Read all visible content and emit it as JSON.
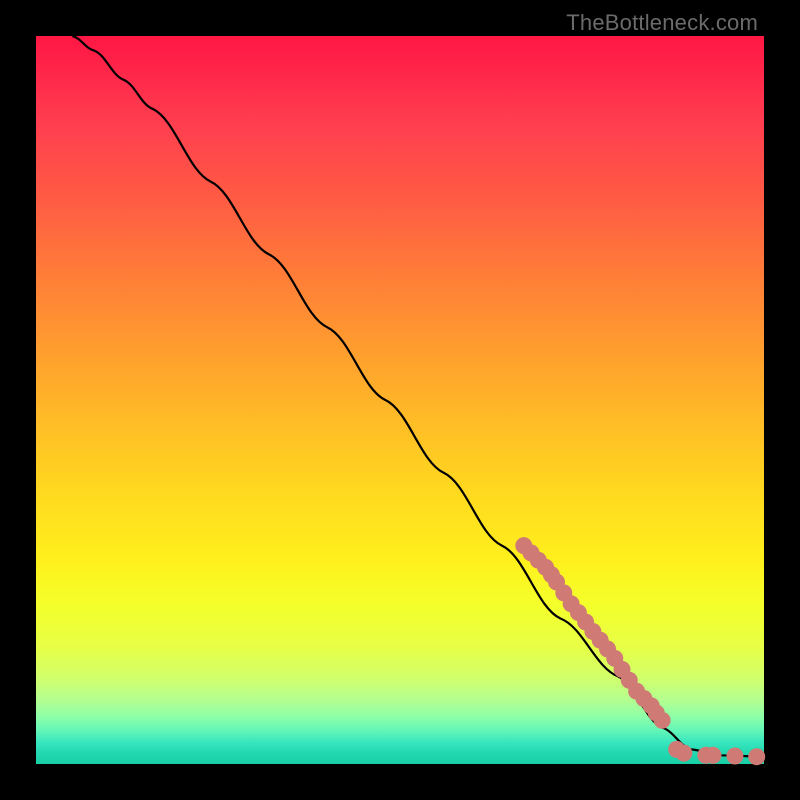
{
  "watermark": "TheBottleneck.com",
  "colors": {
    "dot": "#d07a76",
    "curve": "#000000",
    "frame": "#000000"
  },
  "chart_data": {
    "type": "line",
    "title": "",
    "xlabel": "",
    "ylabel": "",
    "xlim": [
      0,
      100
    ],
    "ylim": [
      0,
      100
    ],
    "grid": false,
    "curve_note": "Monotone decreasing curve from top-left to bottom-right, flattening near the floor after x≈88",
    "curve": [
      {
        "x": 5,
        "y": 100
      },
      {
        "x": 8,
        "y": 98
      },
      {
        "x": 12,
        "y": 94
      },
      {
        "x": 16,
        "y": 90
      },
      {
        "x": 24,
        "y": 80
      },
      {
        "x": 32,
        "y": 70
      },
      {
        "x": 40,
        "y": 60
      },
      {
        "x": 48,
        "y": 50
      },
      {
        "x": 56,
        "y": 40
      },
      {
        "x": 64,
        "y": 30
      },
      {
        "x": 72,
        "y": 20
      },
      {
        "x": 80,
        "y": 12
      },
      {
        "x": 86,
        "y": 5
      },
      {
        "x": 90,
        "y": 2
      },
      {
        "x": 94,
        "y": 1.2
      },
      {
        "x": 100,
        "y": 1
      }
    ],
    "series": [
      {
        "name": "markers",
        "points": [
          {
            "x": 67,
            "y": 30
          },
          {
            "x": 68,
            "y": 29
          },
          {
            "x": 69,
            "y": 28
          },
          {
            "x": 70,
            "y": 27
          },
          {
            "x": 70.8,
            "y": 26
          },
          {
            "x": 71.5,
            "y": 25
          },
          {
            "x": 72.5,
            "y": 23.5
          },
          {
            "x": 73.5,
            "y": 22
          },
          {
            "x": 74.5,
            "y": 20.8
          },
          {
            "x": 75.5,
            "y": 19.5
          },
          {
            "x": 76.5,
            "y": 18.2
          },
          {
            "x": 77.5,
            "y": 17
          },
          {
            "x": 78.5,
            "y": 15.8
          },
          {
            "x": 79.5,
            "y": 14.5
          },
          {
            "x": 80.5,
            "y": 13
          },
          {
            "x": 81.5,
            "y": 11.5
          },
          {
            "x": 82.5,
            "y": 10
          },
          {
            "x": 83.5,
            "y": 9
          },
          {
            "x": 84.5,
            "y": 8
          },
          {
            "x": 85.2,
            "y": 7
          },
          {
            "x": 86,
            "y": 6
          },
          {
            "x": 88,
            "y": 2
          },
          {
            "x": 89,
            "y": 1.5
          },
          {
            "x": 92,
            "y": 1.2
          },
          {
            "x": 93,
            "y": 1.2
          },
          {
            "x": 96,
            "y": 1.1
          },
          {
            "x": 99,
            "y": 1
          }
        ]
      }
    ]
  }
}
